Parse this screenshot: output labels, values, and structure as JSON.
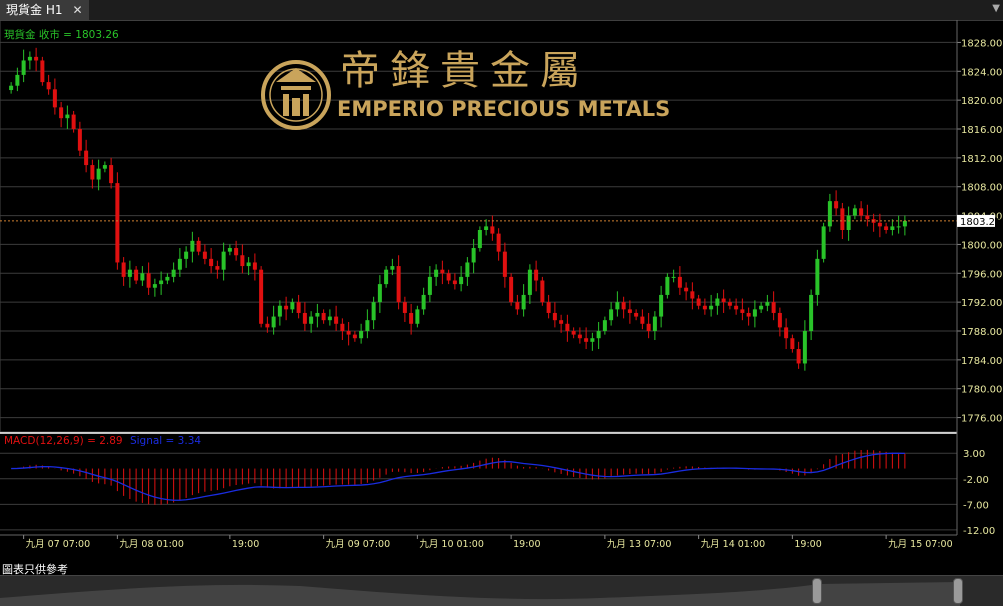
{
  "tab": {
    "label": "現貨金 H1",
    "close": "✕"
  },
  "footer": {
    "disclaimer": "圖表只供參考"
  },
  "logo": {
    "chinese": "帝鋒貴金屬",
    "english": "EMPERIO PRECIOUS METALS",
    "emblem": "emperio-crest-icon"
  },
  "colors": {
    "up": "#29c329",
    "down": "#e01010",
    "grid": "#3c3c3c",
    "axis_text": "#e8e8a0",
    "price_line": "#d08030",
    "macd_hist": "#e01010",
    "signal": "#1a2ce0",
    "gold": "#c9a45b"
  },
  "chart_data": [
    {
      "type": "candlestick",
      "label": "現貨金 收市 = 1803.26",
      "last_price": "1803.26",
      "ylim": [
        1774,
        1830
      ],
      "yticks": [
        "1776.00",
        "1780.00",
        "1784.00",
        "1788.00",
        "1792.00",
        "1796.00",
        "1800.00",
        "1804.00",
        "1808.00",
        "1812.00",
        "1816.00",
        "1820.00",
        "1824.00",
        "1828.00"
      ],
      "closes": [
        1822.0,
        1823.5,
        1825.5,
        1826.0,
        1825.5,
        1822.5,
        1821.5,
        1819.0,
        1817.5,
        1818.0,
        1816.0,
        1813.0,
        1811.0,
        1809.0,
        1810.5,
        1811.0,
        1808.5,
        1797.5,
        1795.5,
        1796.5,
        1795.0,
        1796.0,
        1794.0,
        1794.5,
        1795.0,
        1795.5,
        1796.5,
        1798.0,
        1799.0,
        1800.5,
        1799.0,
        1798.0,
        1797.0,
        1796.5,
        1799.0,
        1799.5,
        1798.5,
        1797.0,
        1797.5,
        1796.5,
        1789.0,
        1788.5,
        1790.0,
        1791.5,
        1791.0,
        1792.0,
        1790.5,
        1789.0,
        1790.0,
        1790.5,
        1789.5,
        1790.0,
        1789.0,
        1788.0,
        1787.5,
        1787.0,
        1788.0,
        1789.5,
        1792.0,
        1794.5,
        1796.5,
        1797.0,
        1792.0,
        1790.5,
        1789.0,
        1791.0,
        1793.0,
        1795.5,
        1796.5,
        1796.0,
        1795.0,
        1794.5,
        1795.5,
        1797.5,
        1799.5,
        1802.0,
        1802.5,
        1801.5,
        1799.0,
        1795.5,
        1792.0,
        1791.0,
        1793.0,
        1796.5,
        1795.0,
        1792.0,
        1790.5,
        1789.5,
        1789.0,
        1788.0,
        1787.5,
        1787.0,
        1786.5,
        1787.0,
        1788.0,
        1789.5,
        1791.0,
        1792.0,
        1791.0,
        1790.5,
        1790.0,
        1789.0,
        1788.0,
        1790.0,
        1793.0,
        1795.5,
        1795.5,
        1794.0,
        1793.5,
        1792.5,
        1791.5,
        1791.0,
        1791.5,
        1792.5,
        1792.0,
        1791.5,
        1791.0,
        1790.5,
        1790.0,
        1791.0,
        1791.5,
        1792.0,
        1790.5,
        1788.5,
        1787.0,
        1785.5,
        1783.5,
        1788.0,
        1793.0,
        1798.0,
        1802.5,
        1806.0,
        1805.0,
        1802.0,
        1804.0,
        1805.0,
        1804.0,
        1803.5,
        1803.0,
        1802.5,
        1802.0,
        1802.5,
        1802.5,
        1803.26
      ]
    },
    {
      "type": "macd",
      "label": "MACD(12,26,9) = 2.89",
      "signal_label": "Signal = 3.34",
      "ylim": [
        -13,
        5
      ],
      "yticks": [
        "3.00",
        "-2.00",
        "-7.00",
        "-12.00"
      ],
      "x_ticks": [
        "九月 07 07:00",
        "九月 08 01:00",
        "19:00",
        "九月 09 07:00",
        "九月 10 01:00",
        "19:00",
        "九月 13 07:00",
        "九月 14 01:00",
        "19:00",
        "九月 15 07:00"
      ],
      "x_tick_bars": [
        2,
        17,
        35,
        50,
        65,
        80,
        95,
        110,
        125,
        140
      ]
    }
  ]
}
